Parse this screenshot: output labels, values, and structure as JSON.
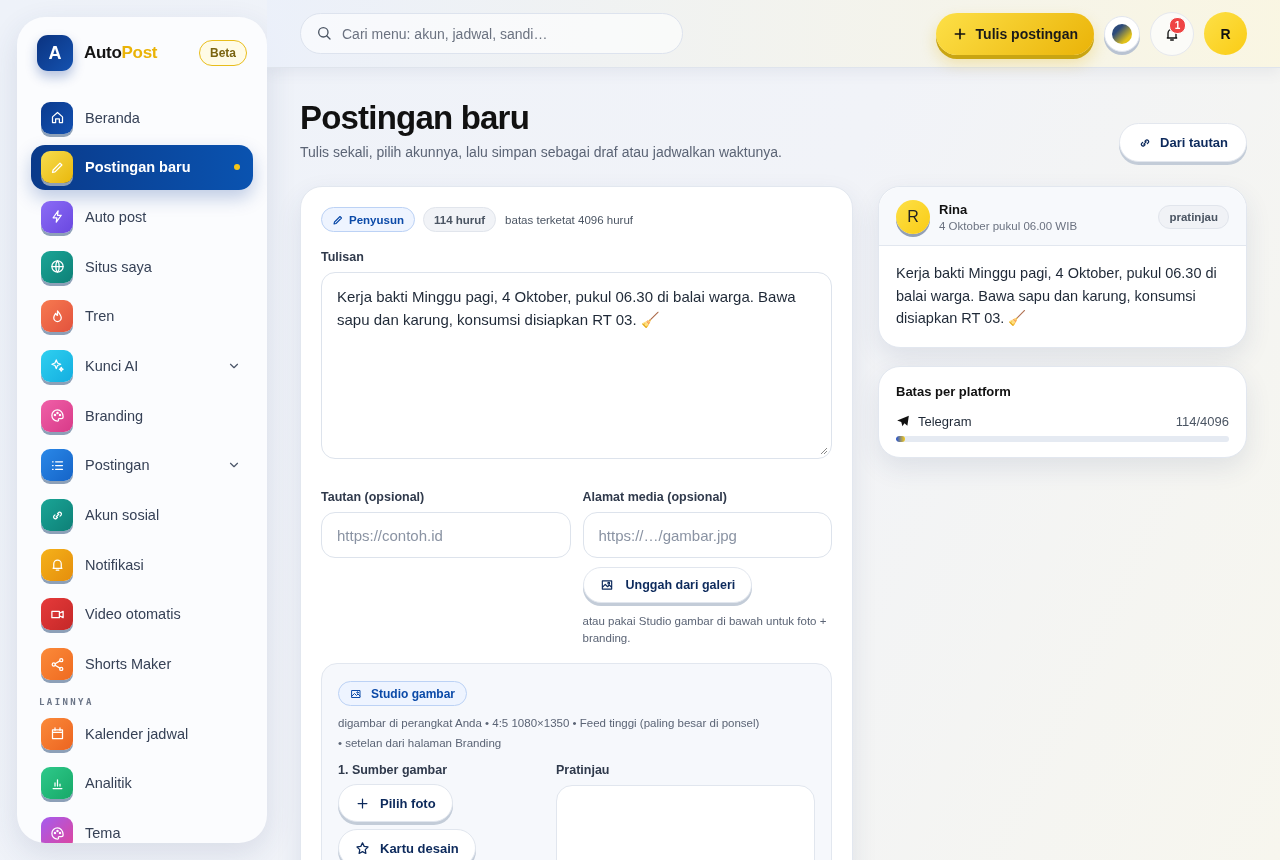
{
  "sidebar": {
    "logo_letter": "A",
    "brand_start": "Auto",
    "brand_end": "Post",
    "badge": "Beta",
    "items": [
      {
        "kind": "link",
        "label": "Beranda",
        "selected": false
      },
      {
        "kind": "link",
        "label": "Postingan baru",
        "selected": true
      },
      {
        "kind": "link",
        "label": "Auto post",
        "selected": false
      },
      {
        "kind": "link",
        "label": "Situs saya",
        "selected": false
      },
      {
        "kind": "link",
        "label": "Tren",
        "selected": false
      },
      {
        "kind": "group",
        "label": "Kunci AI",
        "selected": false,
        "expanded": false
      },
      {
        "kind": "link",
        "label": "Branding",
        "selected": false
      },
      {
        "kind": "group",
        "label": "Postingan",
        "selected": false,
        "expanded": false
      },
      {
        "kind": "link",
        "label": "Akun sosial",
        "selected": false
      },
      {
        "kind": "link",
        "label": "Notifikasi",
        "selected": false
      },
      {
        "kind": "link",
        "label": "Video otomatis",
        "selected": false
      },
      {
        "kind": "link",
        "label": "Shorts Maker",
        "selected": false
      },
      {
        "kind": "heading",
        "label": "LAINNYA"
      },
      {
        "kind": "link",
        "label": "Kalender jadwal",
        "selected": false
      },
      {
        "kind": "link",
        "label": "Analitik",
        "selected": false
      },
      {
        "kind": "link",
        "label": "Tema",
        "selected": false
      }
    ]
  },
  "topbar": {
    "search": {
      "placeholder": "Cari menu: akun, jadwal, sandi…"
    },
    "write_button": "Tulis postingan",
    "notification_count": "1",
    "avatar": "R"
  },
  "header": {
    "title": "Postingan baru",
    "subtitle": "Tulis sekali, pilih akunnya, lalu simpan sebagai draf atau jadwalkan waktunya.",
    "link_button": "Dari tautan"
  },
  "composer": {
    "mode_chip": "Penyusun",
    "count_chip": "114 huruf",
    "limit_note": "batas terketat 4096 huruf",
    "text_label": "Tulisan",
    "text": "Kerja bakti Minggu pagi, 4 Oktober, pukul 06.30 di balai warga. Bawa sapu dan karung, konsumsi disiapkan RT 03. 🧹",
    "link_field": {
      "label": "Tautan (opsional)",
      "placeholder": "https://contoh.id"
    },
    "media_field": {
      "label": "Alamat media (opsional)",
      "placeholder": "https://…/gambar.jpg"
    },
    "upload_button": "Unggah dari galeri",
    "upload_hint": "atau pakai Studio gambar di bawah untuk foto + branding.",
    "studio": {
      "chip": "Studio gambar",
      "info_lines": [
        "digambar di perangkat Anda • 4:5 1080×1350 • Feed tinggi (paling besar di ponsel)",
        "• setelan dari halaman Branding"
      ],
      "source_label": "1. Sumber gambar",
      "source_buttons": [
        "Pilih foto",
        "Kartu desain"
      ],
      "preview_label": "Pratinjau"
    }
  },
  "preview": {
    "avatar": "R",
    "name": "Rina",
    "time": "4 Oktober pukul 06.00 WIB",
    "badge": "pratinjau",
    "text": "Kerja bakti Minggu pagi, 4 Oktober, pukul 06.30 di balai warga. Bawa sapu dan karung, konsumsi disiapkan RT 03. 🧹"
  },
  "limits": {
    "title": "Batas per platform",
    "platforms": [
      {
        "name": "Telegram",
        "count": "114/4096",
        "level": 0.028
      }
    ]
  }
}
